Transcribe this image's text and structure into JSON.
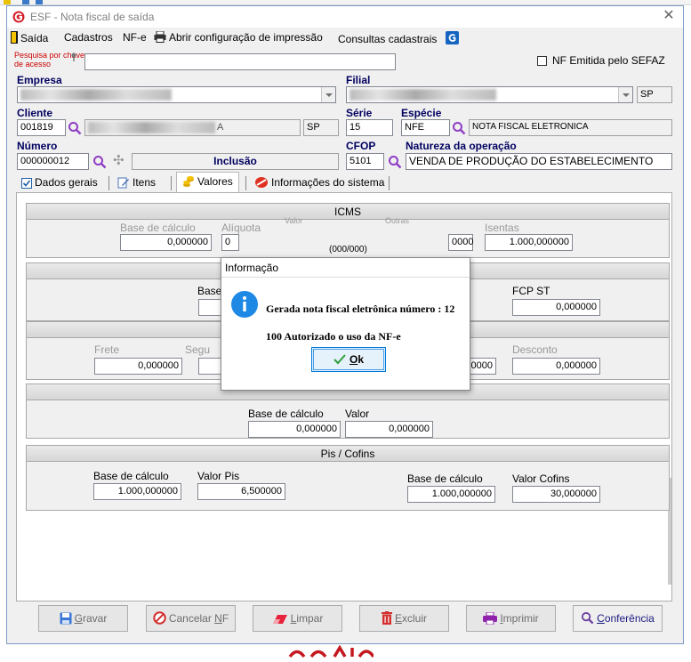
{
  "window": {
    "title": "ESF - Nota fiscal de saída",
    "close_glyph": "✕"
  },
  "menu": [
    {
      "label": "Saída",
      "icon": "door-exit-icon"
    },
    {
      "label": "Cadastros"
    },
    {
      "label": "NF-e"
    },
    {
      "label": "Abrir configuração de impressão",
      "icon": "printer-icon"
    },
    {
      "label": "Consultas cadastrais",
      "icon": "app-badge-icon"
    }
  ],
  "header": {
    "search_label": "Pesquisa por chave de acesso",
    "search_value": "",
    "sefaz_checkbox_label": "NF Emitida pelo SEFAZ",
    "sefaz_checked": false,
    "empresa_label": "Empresa",
    "filial_label": "Filial",
    "filial_uf": "SP",
    "cliente_label": "Cliente",
    "cliente_code": "001819",
    "cliente_suffix": "A",
    "cliente_uf": "SP",
    "serie_label": "Série",
    "serie_value": "15",
    "especie_label": "Espécie",
    "especie_code": "NFE",
    "especie_desc": "NOTA FISCAL ELETRONICA",
    "numero_label": "Número",
    "numero_value": "000000012",
    "status_value": "Inclusão",
    "cfop_label": "CFOP",
    "cfop_value": "5101",
    "natureza_label": "Natureza da operação",
    "natureza_value": "VENDA DE PRODUÇÃO DO ESTABELECIMENTO"
  },
  "tabs": [
    {
      "label": "Dados gerais",
      "icon": "checkbox-icon"
    },
    {
      "label": "Itens",
      "icon": "edit-icon"
    },
    {
      "label": "Valores",
      "icon": "coins-icon",
      "active": true
    },
    {
      "label": "Informações do sistema",
      "icon": "no-entry-icon"
    }
  ],
  "icms": {
    "title": "ICMS",
    "base_label": "Base de cálculo",
    "base_value": "0,000000",
    "aliquota_label": "Alíquota",
    "aliquota_value": "0",
    "valor_label": "Valor",
    "outras_label": "Outras",
    "outras_value": "0000",
    "isentas_label": "Isentas",
    "isentas_value": "1.000,000000",
    "partial_label": "(000/000)"
  },
  "st": {
    "base_label": "Base",
    "fcp_label": "FCP ST",
    "fcp_value": "0,000000"
  },
  "outros": {
    "frete_label": "Frete",
    "frete_value": "0,000000",
    "seguro_label": "Segu",
    "other_value": "0000",
    "desconto_label": "Desconto",
    "desconto_value": "0,000000"
  },
  "ipi": {
    "base_label": "Base de cálculo",
    "base_value": "0,000000",
    "valor_label": "Valor",
    "valor_value": "0,000000"
  },
  "piscofins": {
    "title": "Pis / Cofins",
    "pis_base_label": "Base de cálculo",
    "pis_base_value": "1.000,000000",
    "pis_valor_label": "Valor Pis",
    "pis_valor_value": "6,500000",
    "cofins_base_label": "Base de cálculo",
    "cofins_base_value": "1.000,000000",
    "cofins_valor_label": "Valor Cofins",
    "cofins_valor_value": "30,000000"
  },
  "footer": {
    "gravar": {
      "pre": "",
      "u": "G",
      "post": "ravar"
    },
    "cancelar": {
      "pre": "Cancelar ",
      "u": "N",
      "post": "F"
    },
    "limpar": {
      "pre": "",
      "u": "L",
      "post": "impar"
    },
    "excluir": {
      "pre": "",
      "u": "E",
      "post": "xcluir"
    },
    "imprimir": {
      "pre": "",
      "u": "I",
      "post": "mprimir"
    },
    "conferencia": {
      "pre": "",
      "u": "C",
      "post": "onferência"
    }
  },
  "dialog": {
    "title": "Informação",
    "message": "Gerada nota fiscal eletrônica número : 12",
    "status": "100 Autorizado o uso da NF-e",
    "ok_u": "O",
    "ok_post": "k"
  },
  "colors": {
    "accent": "#0078d7",
    "label_blue": "#000060",
    "brand_red": "#c41820",
    "info_blue": "#1e88e5"
  }
}
